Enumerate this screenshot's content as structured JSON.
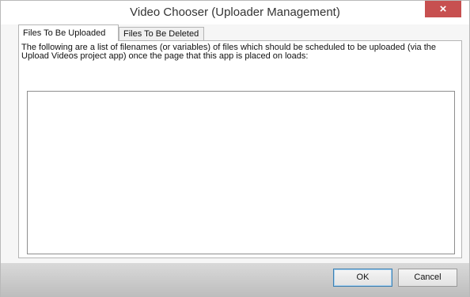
{
  "window": {
    "title": "Video Chooser (Uploader Management)",
    "close_icon": "×"
  },
  "tabs": [
    {
      "label": "Files To Be Uploaded",
      "selected": true
    },
    {
      "label": "Files To Be Deleted",
      "selected": false
    }
  ],
  "panel": {
    "description": "The following are a list of filenames (or variables) of files which should be scheduled to be uploaded (via the Upload Videos project app) once the page that this app is placed on loads:",
    "file_list": []
  },
  "buttons": {
    "ok_label": "OK",
    "cancel_label": "Cancel"
  },
  "colors": {
    "close_button": "#c75050",
    "footer": "#bdbdbd"
  }
}
